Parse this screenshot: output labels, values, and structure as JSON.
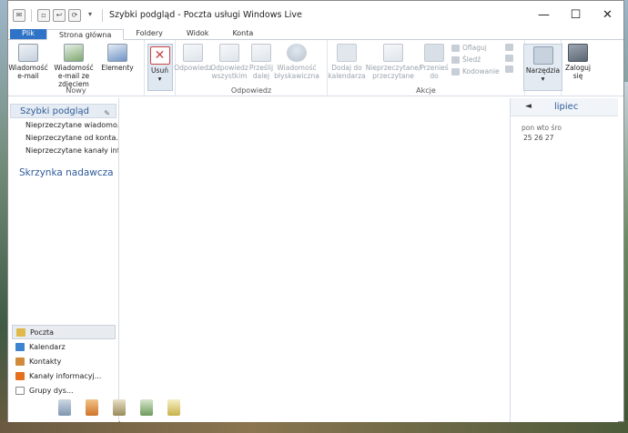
{
  "window": {
    "title": "Szybki podgląd - Poczta usługi Windows Live",
    "controls": {
      "minimize": "—",
      "maximize": "☐",
      "close": "✕"
    }
  },
  "qat": {
    "dropdown": "▾"
  },
  "tabs": [
    "Plik",
    "Strona główna",
    "Foldery",
    "Widok",
    "Konta"
  ],
  "ribbon": {
    "new_group": {
      "label": "Nowy",
      "buttons": [
        "Wiadomość e-mail",
        "Wiadomość e-mail ze zdjęciem",
        "Elementy"
      ]
    },
    "delete": {
      "label": "Usuń",
      "arrow": "▾"
    },
    "reply_group": {
      "label": "Odpowiedz",
      "buttons": [
        "Odpowiedz",
        "Odpowiedz wszystkim",
        "Prześlij dalej",
        "Wiadomość błyskawiczna"
      ]
    },
    "actions_group": {
      "label": "Akcje",
      "buttons": [
        "Dodaj do kalendarza",
        "Nieprzeczytane/ przeczytane",
        "Przenieś do"
      ],
      "small": [
        "Oflaguj",
        "Śledź",
        "Kodowanie"
      ]
    },
    "tools": {
      "label": "Narzędzia",
      "arrow": "▾"
    },
    "signin": {
      "label": "Zaloguj się"
    }
  },
  "sidebar": {
    "header": "Szybki podgląd",
    "pin": "✎",
    "items": [
      "Nieprzeczytane wiadomo...",
      "Nieprzeczytane od konta...",
      "Nieprzeczytane kanały inf..."
    ],
    "outbox": "Skrzynka nadawcza",
    "nav": [
      "Poczta",
      "Kalendarz",
      "Kontakty",
      "Kanały informacyj...",
      "Grupy dys..."
    ]
  },
  "calendar": {
    "arrow": "◄",
    "month": "lipiec",
    "dow": "pon wto śro",
    "days": "25  26 27"
  },
  "colors": {
    "accent": "#2e73c7",
    "link": "#2f5b9b"
  }
}
